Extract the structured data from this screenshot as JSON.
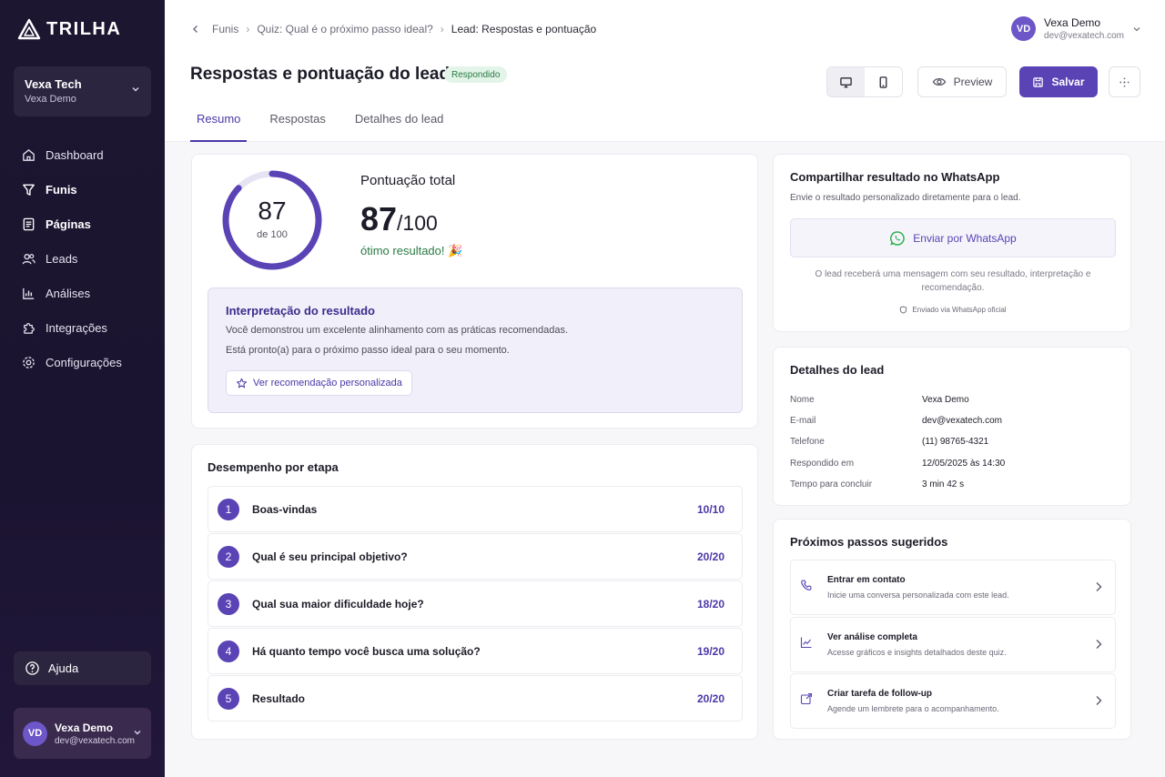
{
  "app": {
    "brand": "TRILHA"
  },
  "workspace": {
    "name": "Vexa Tech",
    "sub": "Vexa Demo"
  },
  "sidebar": {
    "items": [
      {
        "label": "Dashboard",
        "icon": "home-icon"
      },
      {
        "label": "Funis",
        "icon": "funnel-icon"
      },
      {
        "label": "Páginas",
        "icon": "page-icon"
      },
      {
        "label": "Leads",
        "icon": "users-icon"
      },
      {
        "label": "Análises",
        "icon": "chart-icon"
      },
      {
        "label": "Integrações",
        "icon": "puzzle-icon"
      },
      {
        "label": "Configurações",
        "icon": "gear-icon"
      }
    ],
    "help": "Ajuda"
  },
  "user": {
    "initials": "VD",
    "name": "Vexa Demo",
    "email": "dev@vexatech.com"
  },
  "breadcrumb": [
    "Funis",
    "Quiz: Qual é o próximo passo ideal?",
    "Lead: Respostas e pontuação"
  ],
  "header": {
    "title": "Respostas e pontuação do lead",
    "status": "Respondido",
    "preview": "Preview",
    "save": "Salvar"
  },
  "tabs": [
    "Resumo",
    "Respostas",
    "Detalhes do lead"
  ],
  "score": {
    "value": "87",
    "of": "de 100",
    "fraction": 0.87,
    "label": "Pontuação total",
    "big": "87",
    "den": "/100",
    "message": "ótimo resultado! 🎉"
  },
  "interpretation": {
    "title": "Interpretação do resultado",
    "p1": "Você demonstrou um excelente alinhamento com as práticas recomendadas.",
    "p2": "Está pronto(a) para o próximo passo ideal para o seu momento.",
    "button": "Ver recomendação personalizada"
  },
  "performance": {
    "title": "Desempenho por etapa",
    "steps": [
      {
        "n": "1",
        "q": "Boas-vindas",
        "score": "10/10"
      },
      {
        "n": "2",
        "q": "Qual é seu principal objetivo?",
        "score": "20/20"
      },
      {
        "n": "3",
        "q": "Qual sua maior dificuldade hoje?",
        "score": "18/20"
      },
      {
        "n": "4",
        "q": "Há quanto tempo você busca uma solução?",
        "score": "19/20"
      },
      {
        "n": "5",
        "q": "Resultado",
        "score": "20/20"
      }
    ]
  },
  "whatsapp": {
    "title": "Compartilhar resultado no WhatsApp",
    "desc": "Envie o resultado personalizado diretamente para o lead.",
    "button": "Enviar por WhatsApp",
    "note": "O lead receberá uma mensagem com seu resultado, interpretação e recomendação.",
    "official": "Enviado via WhatsApp oficial"
  },
  "details": {
    "title": "Detalhes do lead",
    "rows": [
      {
        "k": "Nome",
        "v": "Vexa Demo"
      },
      {
        "k": "E-mail",
        "v": "dev@vexatech.com"
      },
      {
        "k": "Telefone",
        "v": "(11) 98765-4321"
      },
      {
        "k": "Respondido em",
        "v": "12/05/2025 às 14:30"
      },
      {
        "k": "Tempo para concluir",
        "v": "3 min 42 s"
      }
    ]
  },
  "next": {
    "title": "Próximos passos sugeridos",
    "items": [
      {
        "t": "Entrar em contato",
        "d": "Inicie uma conversa personalizada com este lead."
      },
      {
        "t": "Ver análise completa",
        "d": "Acesse gráficos e insights detalhados deste quiz."
      },
      {
        "t": "Criar tarefa de follow-up",
        "d": "Agende um lembrete para o acompanhamento."
      }
    ]
  },
  "colors": {
    "accent": "#5a43b5",
    "success": "#2a7a45",
    "sidebar": "#1d1631"
  }
}
